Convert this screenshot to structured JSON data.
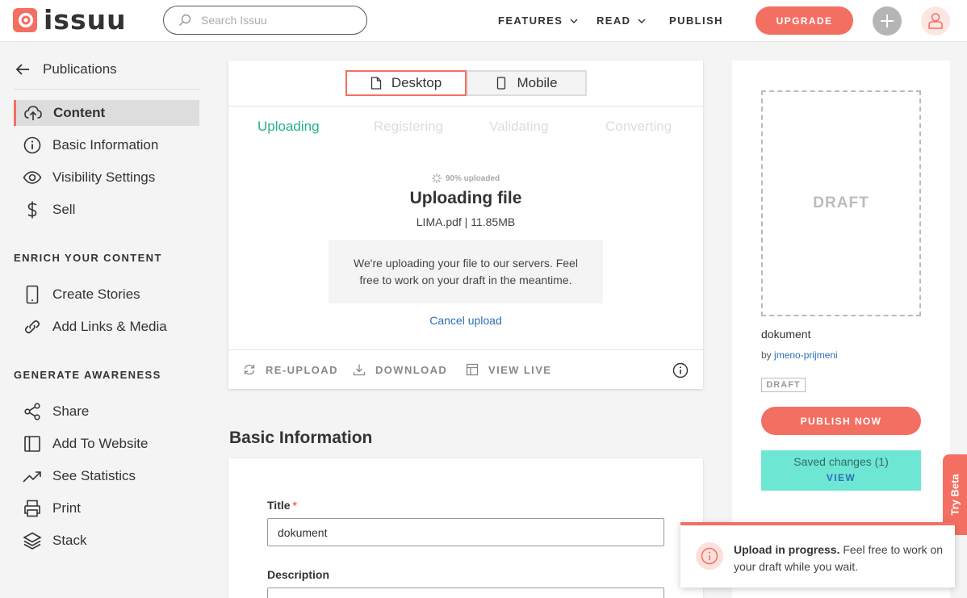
{
  "brand": {
    "name": "issuu",
    "accent": "#f36f62",
    "success": "#25b28e",
    "link": "#2d6fb6"
  },
  "header": {
    "search_placeholder": "Search Issuu",
    "nav": {
      "features": "FEATURES",
      "read": "READ",
      "publish": "PUBLISH"
    },
    "upgrade": "UPGRADE"
  },
  "sidebar": {
    "back_label": "Publications",
    "items": [
      {
        "label": "Content",
        "icon": "cloud-upload-icon",
        "active": true
      },
      {
        "label": "Basic Information",
        "icon": "info-icon"
      },
      {
        "label": "Visibility Settings",
        "icon": "eye-icon"
      },
      {
        "label": "Sell",
        "icon": "dollar-icon"
      }
    ],
    "enrich_heading": "ENRICH YOUR CONTENT",
    "enrich_items": [
      {
        "label": "Create Stories",
        "icon": "phone-icon"
      },
      {
        "label": "Add Links & Media",
        "icon": "link-icon"
      }
    ],
    "awareness_heading": "GENERATE AWARENESS",
    "awareness_items": [
      {
        "label": "Share",
        "icon": "share-icon"
      },
      {
        "label": "Add To Website",
        "icon": "embed-icon"
      },
      {
        "label": "See Statistics",
        "icon": "trend-icon"
      },
      {
        "label": "Print",
        "icon": "printer-icon"
      },
      {
        "label": "Stack",
        "icon": "layers-icon"
      }
    ]
  },
  "upload_card": {
    "view_toggle": {
      "desktop": "Desktop",
      "mobile": "Mobile",
      "selected": "Desktop"
    },
    "steps": [
      "Uploading",
      "Registering",
      "Validating",
      "Converting"
    ],
    "current_step": "Uploading",
    "progress_text": "90% uploaded",
    "title": "Uploading file",
    "file_info": "LIMA.pdf | 11.85MB",
    "message": "We're uploading your file to our servers. Feel free to work on your draft in the meantime.",
    "cancel": "Cancel upload",
    "actions": {
      "reupload": "RE-UPLOAD",
      "download": "DOWNLOAD",
      "view_live": "VIEW LIVE"
    }
  },
  "basic_info": {
    "section_title": "Basic Information",
    "title_label": "Title",
    "required_mark": "*",
    "title_value": "dokument",
    "description_label": "Description"
  },
  "right_panel": {
    "cover_placeholder": "DRAFT",
    "doc_name": "dokument",
    "by_prefix": "by",
    "author": "jmeno-prijmeni",
    "status_badge": "DRAFT",
    "publish_button": "PUBLISH NOW",
    "saved_text": "Saved changes (1)",
    "saved_view": "VIEW"
  },
  "try_beta": "Try Beta",
  "toast": {
    "bold": "Upload in progress.",
    "text": " Feel free to work on your draft while you wait."
  }
}
